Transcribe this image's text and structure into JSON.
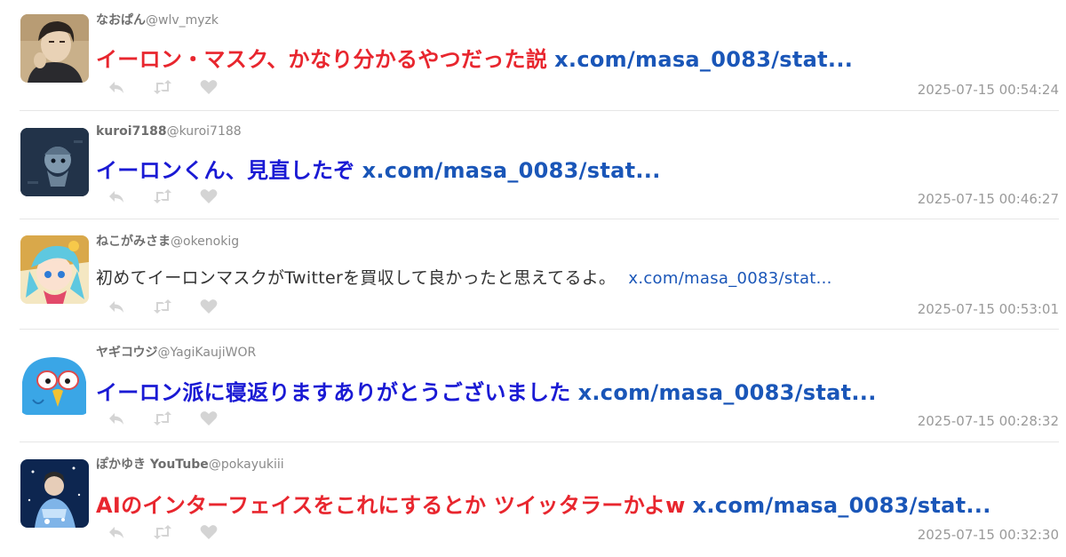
{
  "tweets": [
    {
      "name": "なおぱん",
      "handle": "@wlv_myzk",
      "text": "イーロン・マスク、かなり分かるやつだった説",
      "link": "x.com/masa_0083/stat...",
      "timestamp": "2025-07-15 00:54:24",
      "text_color": "#e8262e"
    },
    {
      "name": "kuroi7188",
      "handle": "@kuroi7188",
      "text": "イーロンくん、見直したぞ",
      "link": "x.com/masa_0083/stat...",
      "timestamp": "2025-07-15 00:46:27",
      "text_color": "#1a1ad4"
    },
    {
      "name": "ねこがみさま",
      "handle": "@okenokig",
      "text": "初めてイーロンマスクがTwitterを買収して良かったと思えてるよ。",
      "link": "x.com/masa_0083/stat...",
      "timestamp": "2025-07-15 00:53:01",
      "text_color": "#333333"
    },
    {
      "name": "ヤギコウジ",
      "handle": "@YagiKaujiWOR",
      "text": "イーロン派に寝返りますありがとうございました",
      "link": "x.com/masa_0083/stat...",
      "timestamp": "2025-07-15 00:28:32",
      "text_color": "#1a1ad4"
    },
    {
      "name": "ぽかゆき YouTube",
      "handle": "@pokayukiii",
      "text": "AIのインターフェイスをこれにするとか ツイッタラーかよw",
      "link": "x.com/masa_0083/stat...",
      "timestamp": "2025-07-15 00:32:30",
      "text_color": "#e8262e"
    }
  ],
  "icons": {
    "reply": "reply-icon",
    "retweet": "retweet-icon",
    "like": "heart-icon"
  },
  "colors": {
    "link": "#1a56b8",
    "icon": "#d4d4d4",
    "meta": "#9a9a9a"
  }
}
